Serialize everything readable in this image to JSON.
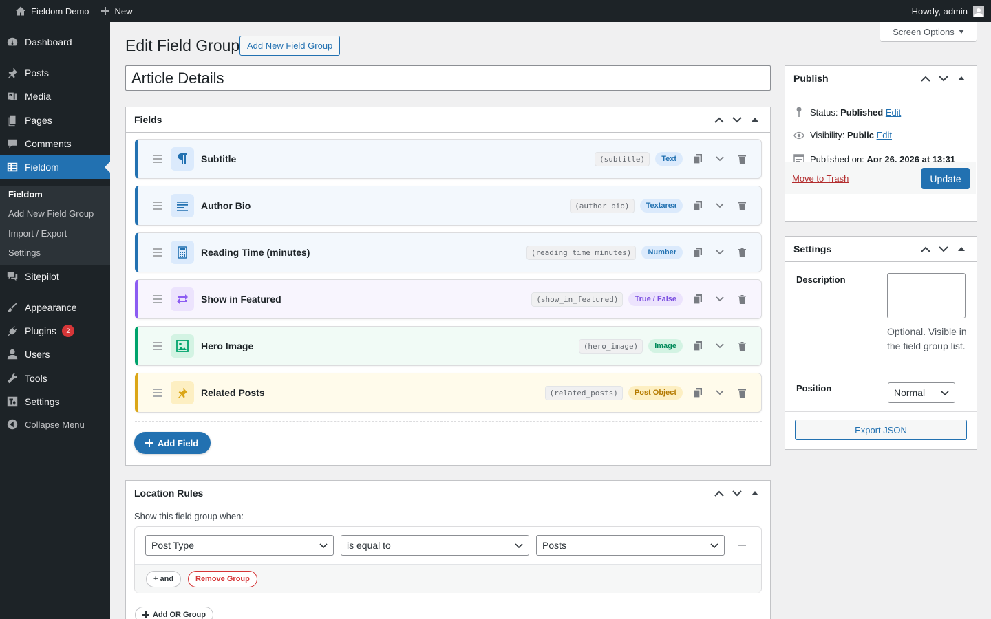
{
  "admin_bar": {
    "site_name": "Fieldom Demo",
    "new_label": "New",
    "howdy": "Howdy, admin"
  },
  "sidebar": {
    "items": [
      {
        "label": "Dashboard",
        "icon": "dashboard-icon"
      },
      {
        "label": "Posts",
        "icon": "pin-icon"
      },
      {
        "label": "Media",
        "icon": "media-icon"
      },
      {
        "label": "Pages",
        "icon": "pages-icon"
      },
      {
        "label": "Comments",
        "icon": "comment-icon"
      },
      {
        "label": "Fieldom",
        "icon": "table-icon"
      },
      {
        "label": "Sitepilot",
        "icon": "chat-icon"
      },
      {
        "label": "Appearance",
        "icon": "brush-icon"
      },
      {
        "label": "Plugins",
        "icon": "plugin-icon",
        "badge": "2"
      },
      {
        "label": "Users",
        "icon": "user-icon"
      },
      {
        "label": "Tools",
        "icon": "wrench-icon"
      },
      {
        "label": "Settings",
        "icon": "settings-icon"
      },
      {
        "label": "Collapse Menu",
        "icon": "collapse-icon"
      }
    ],
    "submenu": [
      "Fieldom",
      "Add New Field Group",
      "Import / Export",
      "Settings"
    ]
  },
  "screen_options": "Screen Options",
  "page": {
    "title": "Edit Field Group",
    "add_new": "Add New Field Group",
    "group_title": "Article Details"
  },
  "fields_box": {
    "title": "Fields",
    "add_field": "Add Field",
    "fields": [
      {
        "label": "Subtitle",
        "key": "(subtitle)",
        "type": "Text",
        "icon": "paragraph-icon",
        "accent": "#2271b1",
        "bg": "#f3f8fd",
        "badge_bg": "#dbeafc",
        "badge_color": "#2271b1"
      },
      {
        "label": "Author Bio",
        "key": "(author_bio)",
        "type": "Textarea",
        "icon": "text-lines-icon",
        "accent": "#2271b1",
        "bg": "#f3f8fd",
        "badge_bg": "#dbeafc",
        "badge_color": "#2271b1"
      },
      {
        "label": "Reading Time (minutes)",
        "key": "(reading_time_minutes)",
        "type": "Number",
        "icon": "calculator-icon",
        "accent": "#2271b1",
        "bg": "#f3f8fd",
        "badge_bg": "#dbeafc",
        "badge_color": "#2271b1"
      },
      {
        "label": "Show in Featured",
        "key": "(show_in_featured)",
        "type": "True / False",
        "icon": "toggle-arrows-icon",
        "accent": "#8c5cf2",
        "bg": "#f8f5fe",
        "badge_bg": "#ece3fd",
        "badge_color": "#7b4ee0"
      },
      {
        "label": "Hero Image",
        "key": "(hero_image)",
        "type": "Image",
        "icon": "image-icon",
        "accent": "#00a36c",
        "bg": "#f1fbf6",
        "badge_bg": "#d3f3e3",
        "badge_color": "#008a5a"
      },
      {
        "label": "Related Posts",
        "key": "(related_posts)",
        "type": "Post Object",
        "icon": "pin-icon",
        "accent": "#dba617",
        "bg": "#fffbeb",
        "badge_bg": "#fdefc2",
        "badge_color": "#b47a00"
      }
    ]
  },
  "location_box": {
    "title": "Location Rules",
    "intro": "Show this field group when:",
    "param": "Post Type",
    "operator": "is equal to",
    "value": "Posts",
    "and_label": "+ and",
    "remove_group": "Remove Group",
    "add_or_group": "Add OR Group"
  },
  "publish_box": {
    "title": "Publish",
    "status_label": "Status:",
    "status_value": "Published",
    "visibility_label": "Visibility:",
    "visibility_value": "Public",
    "published_label": "Published on:",
    "published_value": "Apr 26, 2026 at 13:31",
    "edit": "Edit",
    "trash": "Move to Trash",
    "update": "Update"
  },
  "settings_box": {
    "title": "Settings",
    "description_label": "Description",
    "description_value": "",
    "description_help": "Optional. Visible in the field group list.",
    "position_label": "Position",
    "position_value": "Normal",
    "export": "Export JSON"
  }
}
